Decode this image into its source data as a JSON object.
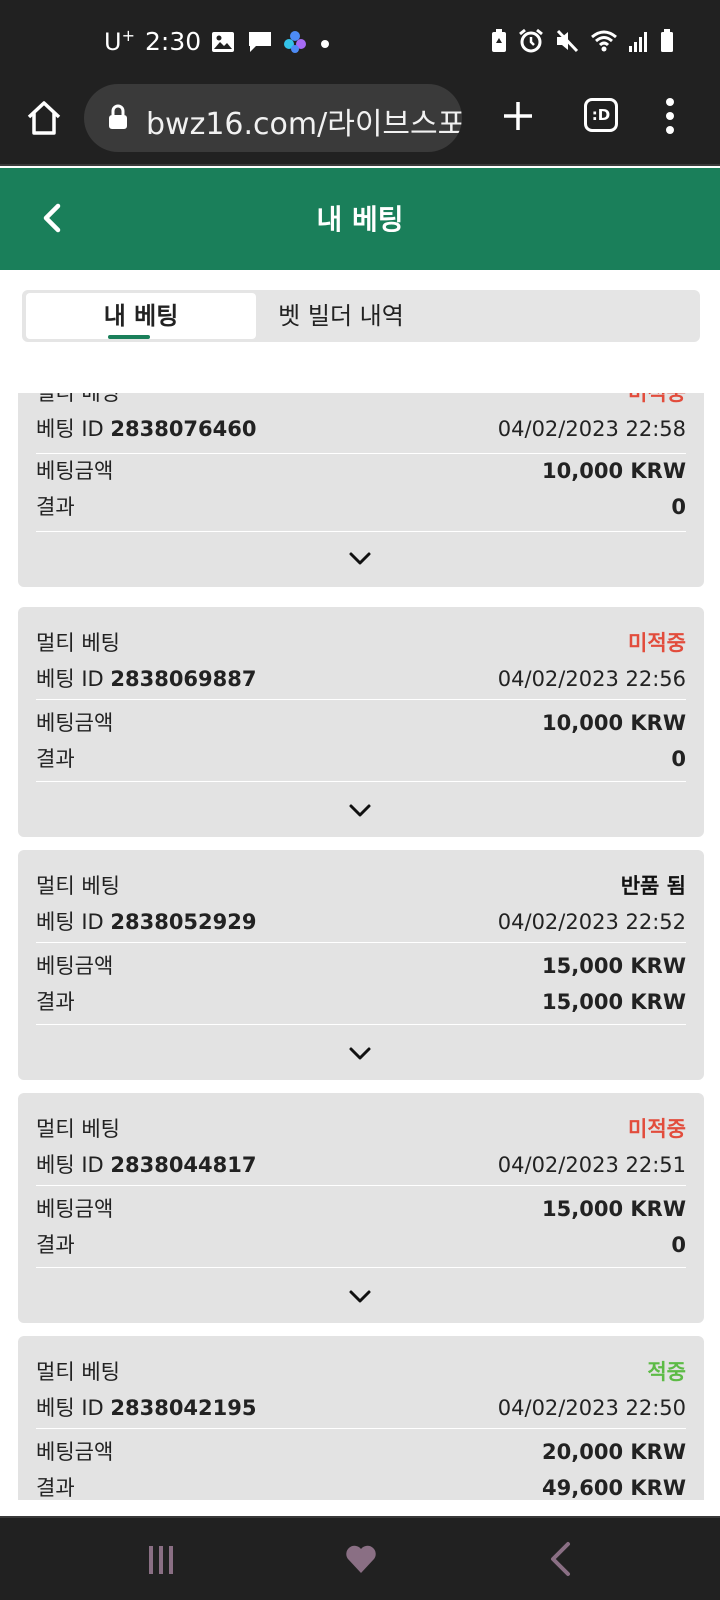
{
  "status_bar": {
    "carrier": "U",
    "carrier_sup": "+",
    "time": "2:30"
  },
  "browser": {
    "url": "bwz16.com/라이브스포",
    "tabs_label": ":D"
  },
  "header": {
    "title": "내 베팅"
  },
  "tabs": [
    {
      "label": "내 베팅",
      "active": true
    },
    {
      "label": "벳 빌더 내역",
      "active": false
    }
  ],
  "labels": {
    "bet_id_prefix": "베팅 ID",
    "amount_label": "베팅금액",
    "result_label": "결과"
  },
  "bets": [
    {
      "type": "멀티 베팅",
      "status": "미적중",
      "status_color": "#e24c3c",
      "id": "2838076460",
      "datetime": "04/02/2023 22:58",
      "amount": "10,000 KRW",
      "result": "0"
    },
    {
      "type": "멀티 베팅",
      "status": "미적중",
      "status_color": "#e24c3c",
      "id": "2838069887",
      "datetime": "04/02/2023 22:56",
      "amount": "10,000 KRW",
      "result": "0"
    },
    {
      "type": "멀티 베팅",
      "status": "반품 됨",
      "status_color": "#111111",
      "id": "2838052929",
      "datetime": "04/02/2023 22:52",
      "amount": "15,000 KRW",
      "result": "15,000 KRW"
    },
    {
      "type": "멀티 베팅",
      "status": "미적중",
      "status_color": "#e24c3c",
      "id": "2838044817",
      "datetime": "04/02/2023 22:51",
      "amount": "15,000 KRW",
      "result": "0"
    },
    {
      "type": "멀티 베팅",
      "status": "적중",
      "status_color": "#5dbb46",
      "id": "2838042195",
      "datetime": "04/02/2023 22:50",
      "amount": "20,000 KRW",
      "result": "49,600 KRW"
    }
  ],
  "colors": {
    "brand_green": "#1a7f5a",
    "card_bg": "#e3e3e3",
    "system_bar": "#212121"
  }
}
